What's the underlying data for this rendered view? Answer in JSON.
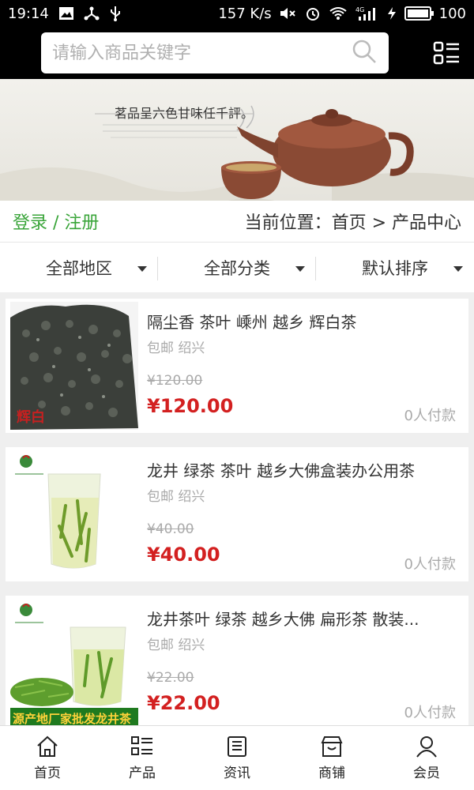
{
  "status_bar": {
    "time": "19:14",
    "net_speed": "157 K/s",
    "network": "4G",
    "battery": "100",
    "battery_level": 1.0
  },
  "search": {
    "placeholder": "请输入商品关键字"
  },
  "banner": {
    "caption": "茗品呈六色甘味任千評。"
  },
  "top_row": {
    "login_register": "登录 / 注册",
    "breadcrumb": "当前位置：首页 > 产品中心"
  },
  "filters": [
    {
      "label": "全部地区"
    },
    {
      "label": "全部分类"
    },
    {
      "label": "默认排序"
    }
  ],
  "products": [
    {
      "name": "隔尘香 茶叶 嵊州 越乡 辉白茶",
      "shipping": "包邮 绍兴",
      "original_price": "¥120.00",
      "price": "¥120.00",
      "sold": "0人付款",
      "image_label": "辉白"
    },
    {
      "name": "龙井 绿茶 茶叶 越乡大佛盒装办公用茶",
      "shipping": "包邮 绍兴",
      "original_price": "¥40.00",
      "price": "¥40.00",
      "sold": "0人付款",
      "image_label": ""
    },
    {
      "name": "龙井茶叶 绿茶 越乡大佛 扁形茶 散装...",
      "shipping": "包邮 绍兴",
      "original_price": "¥22.00",
      "price": "¥22.00",
      "sold": "0人付款",
      "image_label": "源产地厂家批发龙井茶"
    }
  ],
  "bottom_nav": [
    {
      "label": "首页",
      "icon": "home-icon"
    },
    {
      "label": "产品",
      "icon": "list-icon"
    },
    {
      "label": "资讯",
      "icon": "news-icon"
    },
    {
      "label": "商铺",
      "icon": "store-icon"
    },
    {
      "label": "会员",
      "icon": "user-icon"
    }
  ],
  "colors": {
    "accent_green": "#3aa53a",
    "price_red": "#d32020"
  }
}
